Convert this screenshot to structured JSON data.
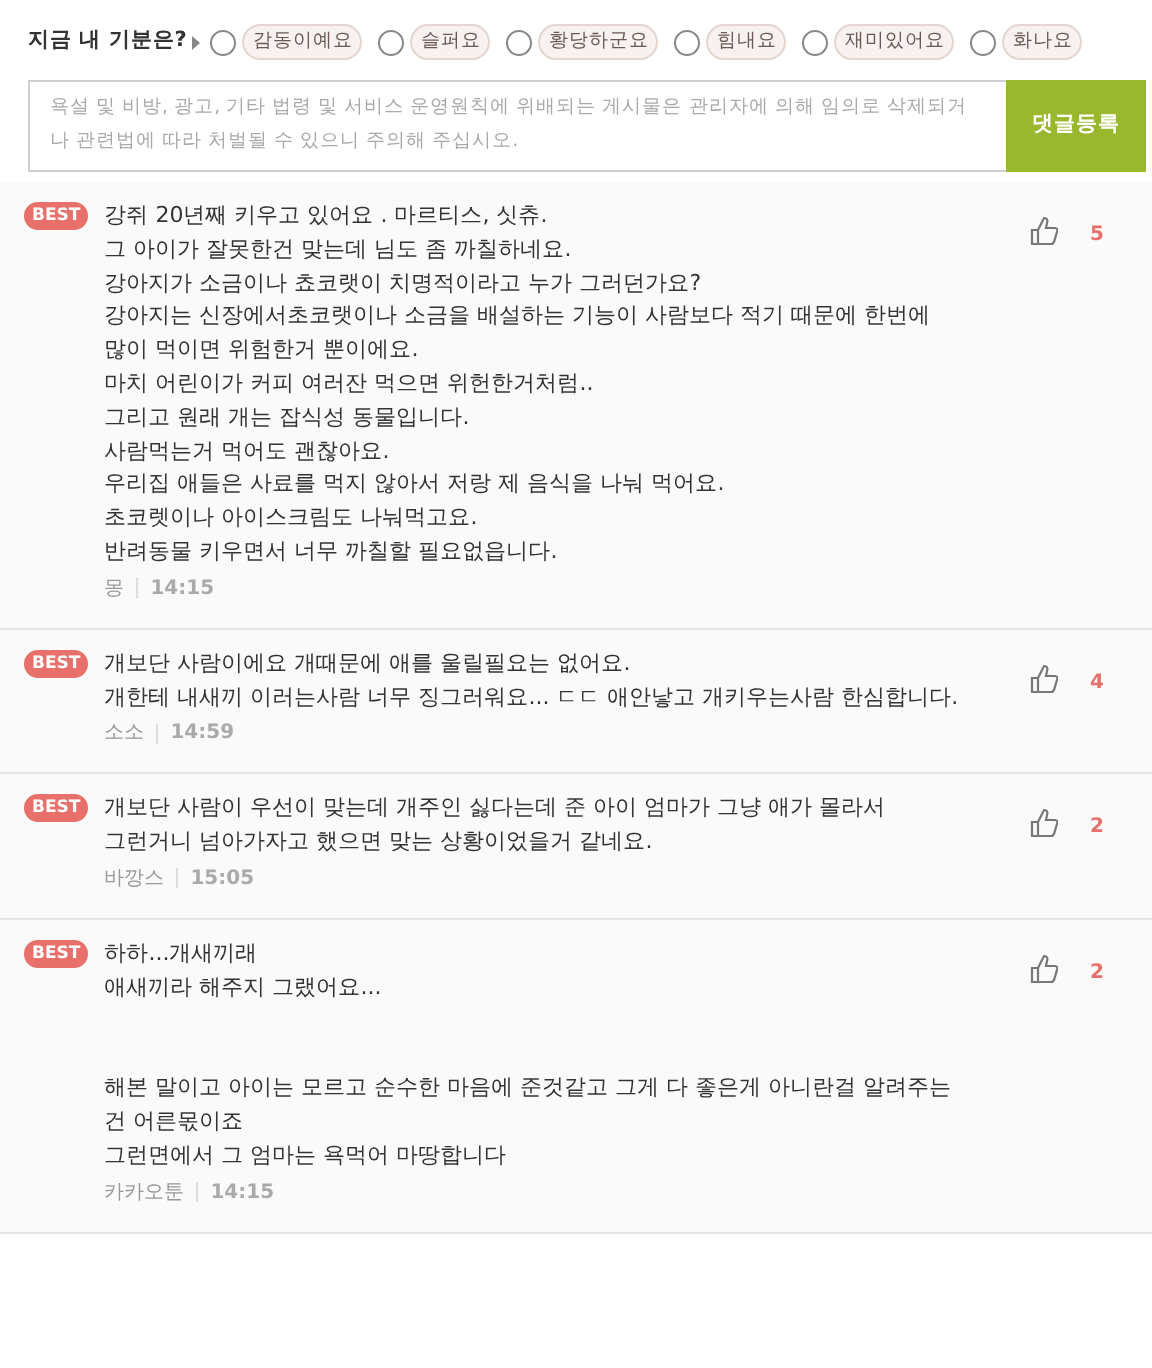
{
  "mood": {
    "label": "지금 내 기분은?",
    "options": [
      {
        "label": "감동이예요",
        "selected": false
      },
      {
        "label": "슬퍼요",
        "selected": false
      },
      {
        "label": "황당하군요",
        "selected": false
      },
      {
        "label": "힘내요",
        "selected": false
      },
      {
        "label": "재미있어요",
        "selected": false
      },
      {
        "label": "화나요",
        "selected": false
      }
    ]
  },
  "comment_form": {
    "placeholder": "욕설 및 비방, 광고, 기타 법령 및 서비스 운영원칙에 위배되는 게시물은 관리자에 의해 임의로 삭제되거나 관련법에 따라 처벌될 수 있으니 주의해 주십시오.",
    "submit": "댓글등록"
  },
  "comments": [
    {
      "badge": "BEST",
      "text": "강쥐 20년째 키우고 있어요 . 마르티스, 싯츄.\n그 아이가 잘못한건 맞는데 님도 좀 까칠하네요.\n강아지가 소금이나 쵸코랫이 치명적이라고 누가 그러던가요?\n강아지는 신장에서초코랫이나 소금을 배설하는 기능이 사람보다 적기 때문에 한번에 많이 먹이면 위험한거 뿐이에요.\n마치 어린이가 커피 여러잔 먹으면 위헌한거처럼..\n그리고 원래 개는 잡식성 동물입니다.\n사람먹는거 먹어도 괜찮아요.\n우리집 애들은 사료를 먹지 않아서 저랑 제 음식을 나눠 먹어요.\n초코렛이나 아이스크림도 나눠먹고요.\n반려동물 키우면서 너무 까칠할 필요없읍니다.",
      "author": "몽",
      "time": "14:15",
      "likes": "5"
    },
    {
      "badge": "BEST",
      "text": "개보단 사람이에요 개때문에 애를 울릴필요는 없어요.\n개한테 내새끼 이러는사람 너무 징그러워요... ㄷㄷ 애안낳고 개키우는사람 한심합니다.",
      "author": "소소",
      "time": "14:59",
      "likes": "4"
    },
    {
      "badge": "BEST",
      "text": "개보단 사람이 우선이 맞는데 개주인 싫다는데 준 아이 엄마가 그냥 애가 몰라서 그런거니 넘아가자고 했으면 맞는 상황이었을거 같네요.",
      "author": "바깡스",
      "time": "15:05",
      "likes": "2"
    },
    {
      "badge": "BEST",
      "text": "하하...개새끼래\n애새끼라 해주지 그랬어요...\n\n\n해본 말이고 아이는 모르고 순수한 마음에 준것같고 그게 다 좋은게 아니란걸 알려주는 건 어른몫이죠\n그런면에서 그 엄마는 욕먹어 마땅합니다",
      "author": "카카오툰",
      "time": "14:15",
      "likes": "2"
    }
  ]
}
